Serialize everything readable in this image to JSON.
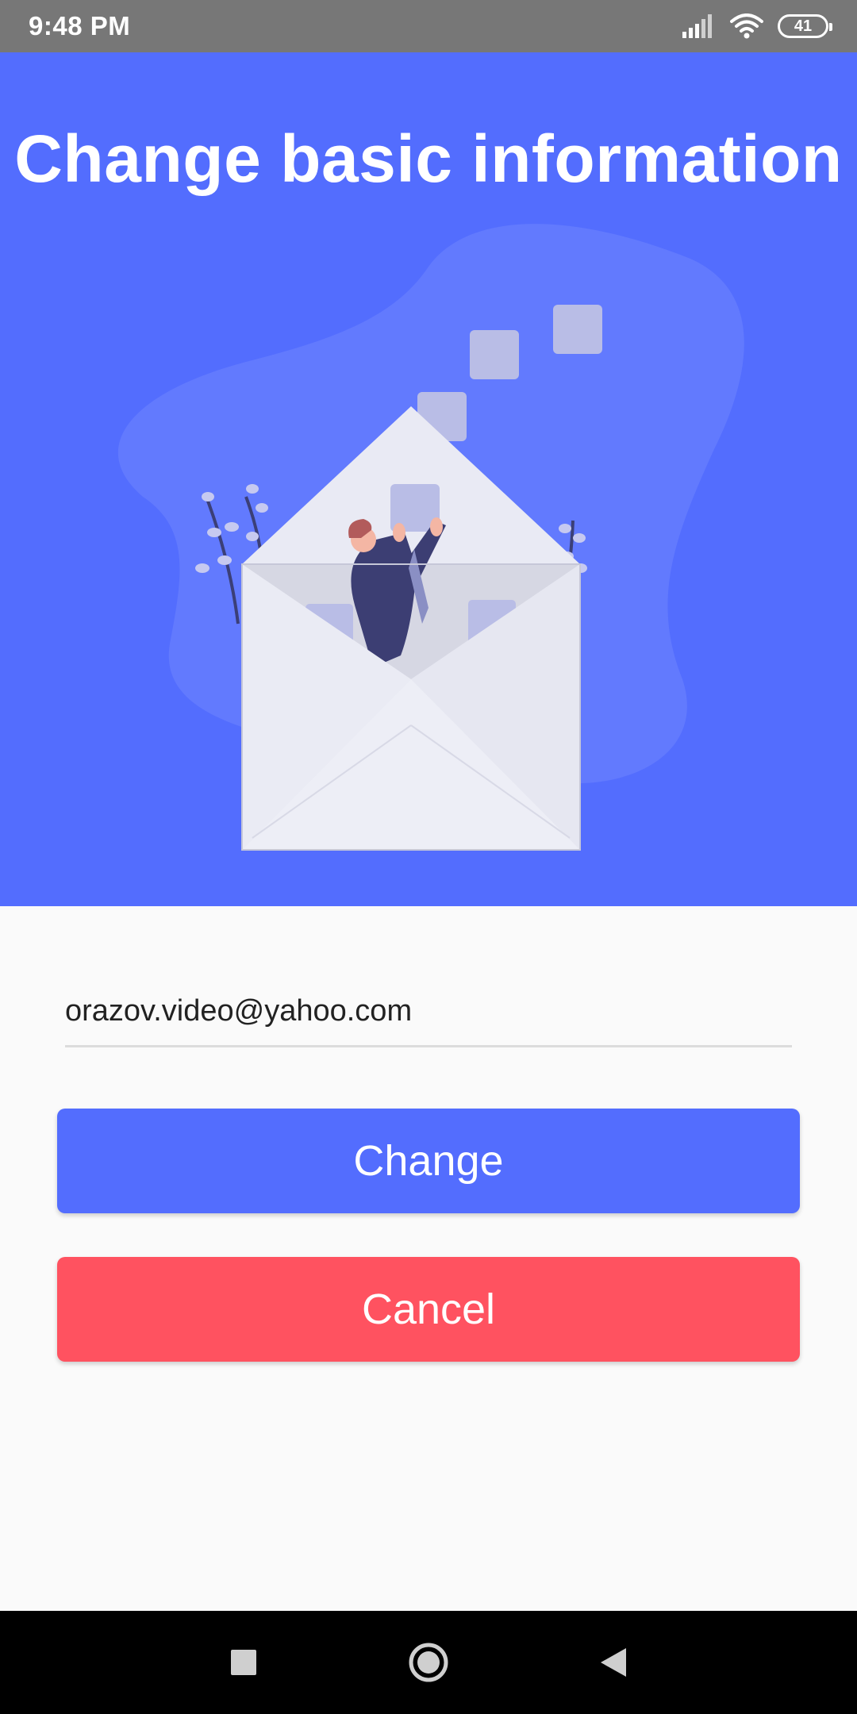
{
  "status_bar": {
    "time": "9:48 PM",
    "battery_level": "41",
    "icons": [
      "signal-icon",
      "wifi-icon",
      "battery-icon"
    ]
  },
  "hero": {
    "title": "Change basic information",
    "background_color": "#536dfe",
    "illustration": "envelope-illustration"
  },
  "form": {
    "email_value": "orazov.video@yahoo.com",
    "change_label": "Change",
    "cancel_label": "Cancel",
    "change_color": "#536dfe",
    "cancel_color": "#ff5260"
  },
  "nav_bar": {
    "icons": [
      "recent-apps-icon",
      "home-icon",
      "back-icon"
    ]
  }
}
